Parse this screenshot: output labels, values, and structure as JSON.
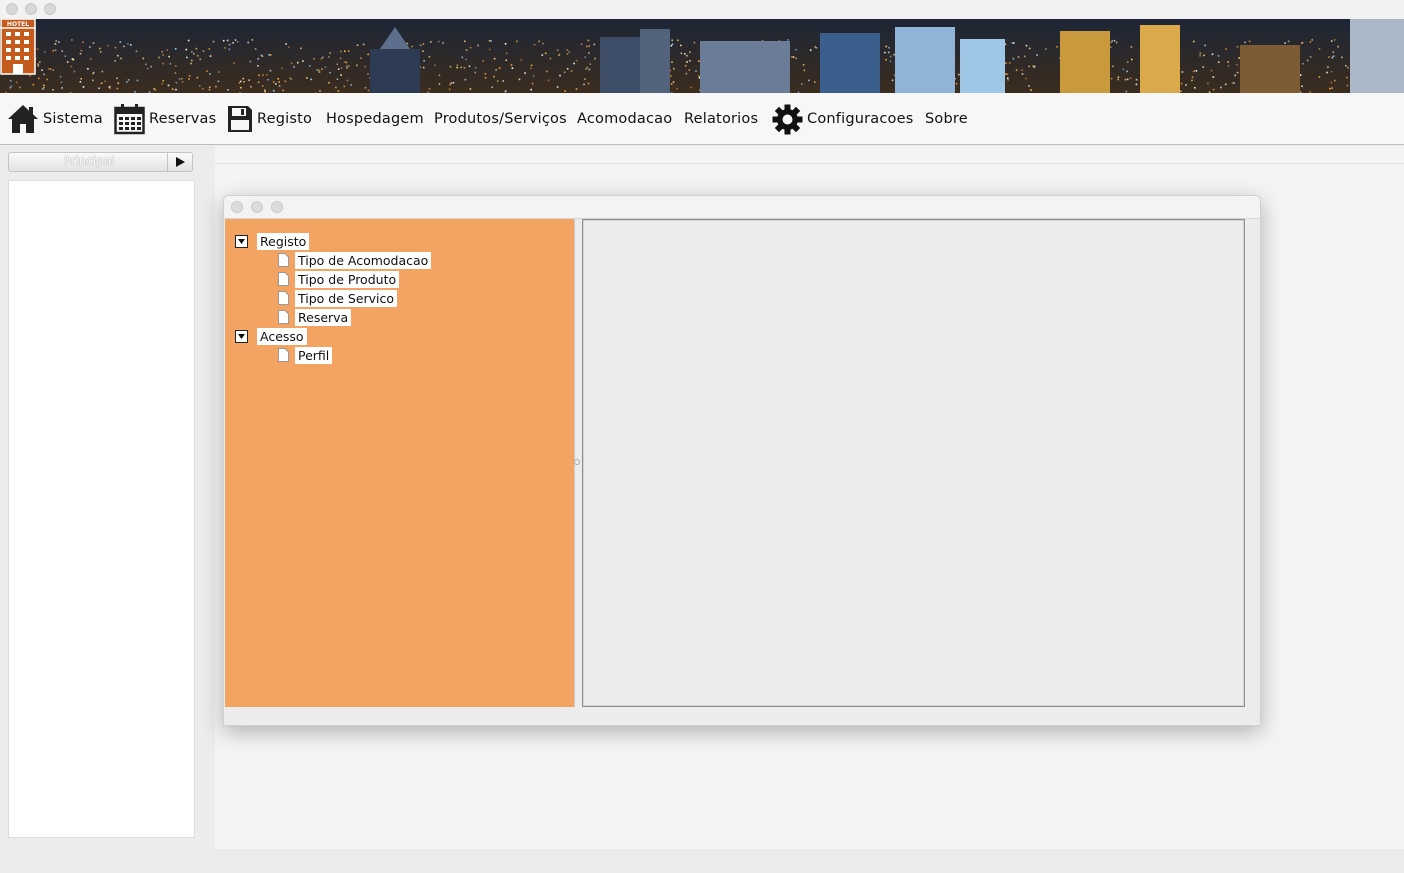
{
  "app": {
    "logo_text": "HOTEL"
  },
  "menu": [
    {
      "label": "Sistema",
      "icon": "home-icon"
    },
    {
      "label": "Reservas",
      "icon": "calendar-icon"
    },
    {
      "label": "Registo",
      "icon": "floppy-disk-icon"
    },
    {
      "label": "Hospedagem",
      "icon": ""
    },
    {
      "label": "Produtos/Serviços",
      "icon": ""
    },
    {
      "label": "Acomodacao",
      "icon": ""
    },
    {
      "label": "Relatorios",
      "icon": ""
    },
    {
      "label": "Configuracoes",
      "icon": "gear-icon"
    },
    {
      "label": "Sobre",
      "icon": ""
    }
  ],
  "sidebar": {
    "header_label": "Principal",
    "toggle_icon": "play-arrow-icon"
  },
  "tree": {
    "nodes": [
      {
        "label": "Registo",
        "expanded": true,
        "children": [
          {
            "label": "Tipo de Acomodacao"
          },
          {
            "label": "Tipo de Produto"
          },
          {
            "label": "Tipo de Servico"
          },
          {
            "label": "Reserva"
          }
        ]
      },
      {
        "label": "Acesso",
        "expanded": true,
        "children": [
          {
            "label": "Perfil"
          }
        ]
      }
    ]
  },
  "colors": {
    "tree_background": "#f4a462",
    "menubar_background": "#f7f7f7",
    "desktop_background": "#f4f4f4"
  }
}
